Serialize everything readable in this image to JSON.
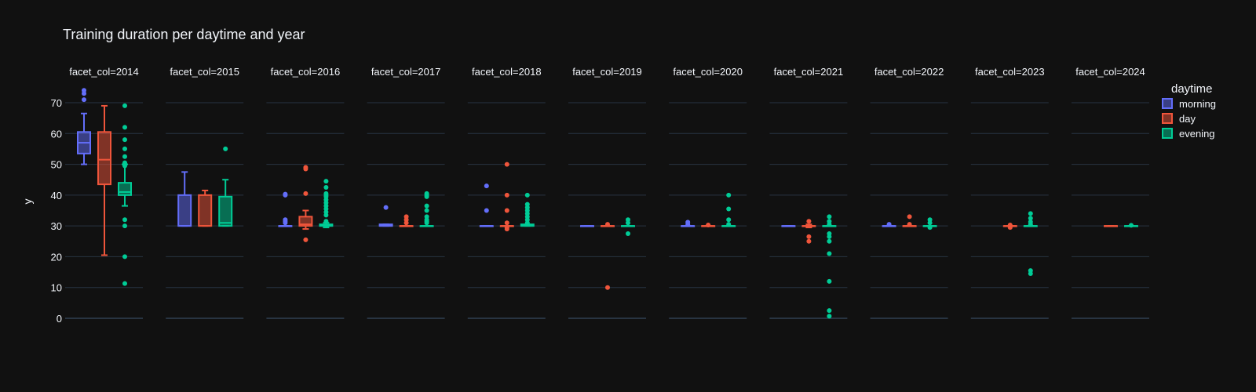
{
  "chart_data": {
    "type": "box",
    "title": "Training duration per daytime and year",
    "ylabel": "y",
    "ylim": [
      0,
      75
    ],
    "yticks": [
      0,
      10,
      20,
      30,
      40,
      50,
      60,
      70
    ],
    "facet_prefix": "facet_col=",
    "legend_title": "daytime",
    "legend_position": "right",
    "grid": true,
    "facets": [
      {
        "label": "facet_col=2014",
        "boxes": {
          "morning": {
            "q1": 53.5,
            "median": 57,
            "q3": 60.5,
            "low": 50,
            "high": 66.5,
            "outliers": [
              71,
              73,
              74
            ]
          },
          "day": {
            "q1": 43.5,
            "median": 51.5,
            "q3": 60.5,
            "low": 20.5,
            "high": 69,
            "outliers": []
          },
          "evening": {
            "q1": 40,
            "median": 41,
            "q3": 44,
            "low": 36.5,
            "high": 50,
            "outliers": [
              11.3,
              20,
              30,
              32,
              49.5,
              50.5,
              52.5,
              55,
              58,
              62,
              69
            ]
          }
        }
      },
      {
        "label": "facet_col=2015",
        "boxes": {
          "morning": {
            "q1": 30,
            "median": 30,
            "q3": 40,
            "low": 30,
            "high": 47.5,
            "outliers": []
          },
          "day": {
            "q1": 30,
            "median": 30,
            "q3": 40,
            "low": 30,
            "high": 41.5,
            "outliers": []
          },
          "evening": {
            "q1": 30,
            "median": 31,
            "q3": 39.5,
            "low": 30,
            "high": 45,
            "outliers": [
              55
            ]
          }
        }
      },
      {
        "label": "facet_col=2016",
        "boxes": {
          "morning": {
            "q1": 30,
            "median": 30,
            "q3": 30,
            "low": 30,
            "high": 30,
            "outliers": [
              31,
              31.5,
              32,
              40,
              40.3
            ]
          },
          "day": {
            "q1": 30,
            "median": 30.5,
            "q3": 33,
            "low": 29,
            "high": 35,
            "outliers": [
              25.5,
              40.5,
              48.5,
              49
            ]
          },
          "evening": {
            "q1": 30,
            "median": 30,
            "q3": 30.5,
            "low": 29.5,
            "high": 31,
            "outliers": [
              31.5,
              33.5,
              34.5,
              35.5,
              36.5,
              37.5,
              38.5,
              39.5,
              40,
              40.5,
              42.5,
              44.5
            ]
          }
        }
      },
      {
        "label": "facet_col=2017",
        "boxes": {
          "morning": {
            "q1": 30,
            "median": 30,
            "q3": 30.5,
            "low": 30,
            "high": 30.5,
            "outliers": [
              36
            ]
          },
          "day": {
            "q1": 30,
            "median": 30,
            "q3": 30,
            "low": 30,
            "high": 30,
            "outliers": [
              31,
              32,
              33
            ]
          },
          "evening": {
            "q1": 30,
            "median": 30,
            "q3": 30,
            "low": 30,
            "high": 30,
            "outliers": [
              31,
              31.5,
              32,
              33,
              35,
              36.5,
              39.5,
              40,
              40.5
            ]
          }
        }
      },
      {
        "label": "facet_col=2018",
        "boxes": {
          "morning": {
            "q1": 30,
            "median": 30,
            "q3": 30,
            "low": 30,
            "high": 30,
            "outliers": [
              35,
              43
            ]
          },
          "day": {
            "q1": 30,
            "median": 30,
            "q3": 30,
            "low": 30,
            "high": 30,
            "outliers": [
              29,
              29.5,
              31,
              35,
              40,
              50
            ]
          },
          "evening": {
            "q1": 30,
            "median": 30,
            "q3": 30.5,
            "low": 30,
            "high": 30.5,
            "outliers": [
              31,
              32,
              33,
              34,
              35,
              36,
              37,
              40
            ]
          }
        }
      },
      {
        "label": "facet_col=2019",
        "boxes": {
          "morning": {
            "q1": 30,
            "median": 30,
            "q3": 30,
            "low": 30,
            "high": 30,
            "outliers": []
          },
          "day": {
            "q1": 30,
            "median": 30,
            "q3": 30,
            "low": 30,
            "high": 30,
            "outliers": [
              10,
              30.5
            ]
          },
          "evening": {
            "q1": 30,
            "median": 30,
            "q3": 30,
            "low": 30,
            "high": 30,
            "outliers": [
              27.5,
              31,
              32
            ]
          }
        }
      },
      {
        "label": "facet_col=2020",
        "boxes": {
          "morning": {
            "q1": 30,
            "median": 30,
            "q3": 30,
            "low": 30,
            "high": 30,
            "outliers": [
              30.5,
              31.2
            ]
          },
          "day": {
            "q1": 30,
            "median": 30,
            "q3": 30,
            "low": 30,
            "high": 30,
            "outliers": [
              30.3
            ]
          },
          "evening": {
            "q1": 30,
            "median": 30,
            "q3": 30,
            "low": 30,
            "high": 30,
            "outliers": [
              30.5,
              32,
              35.5,
              40
            ]
          }
        }
      },
      {
        "label": "facet_col=2021",
        "boxes": {
          "morning": {
            "q1": 30,
            "median": 30,
            "q3": 30,
            "low": 30,
            "high": 30,
            "outliers": []
          },
          "day": {
            "q1": 30,
            "median": 30,
            "q3": 30,
            "low": 29.5,
            "high": 30.5,
            "outliers": [
              25,
              26.5,
              31.5
            ]
          },
          "evening": {
            "q1": 30,
            "median": 30,
            "q3": 30,
            "low": 30,
            "high": 30,
            "outliers": [
              0.7,
              2.5,
              12,
              21,
              25,
              26.5,
              27.5,
              30.5,
              31.5,
              33
            ]
          }
        }
      },
      {
        "label": "facet_col=2022",
        "boxes": {
          "morning": {
            "q1": 30,
            "median": 30,
            "q3": 30,
            "low": 30,
            "high": 30,
            "outliers": [
              30.5
            ]
          },
          "day": {
            "q1": 30,
            "median": 30,
            "q3": 30,
            "low": 30,
            "high": 30,
            "outliers": [
              30.5,
              33
            ]
          },
          "evening": {
            "q1": 30,
            "median": 30,
            "q3": 30,
            "low": 30,
            "high": 30,
            "outliers": [
              29.5,
              31,
              32
            ]
          }
        }
      },
      {
        "label": "facet_col=2023",
        "boxes": {
          "morning": null,
          "day": {
            "q1": 30,
            "median": 30,
            "q3": 30,
            "low": 30,
            "high": 30,
            "outliers": [
              29.5,
              30.3
            ]
          },
          "evening": {
            "q1": 30,
            "median": 30,
            "q3": 30,
            "low": 30,
            "high": 30,
            "outliers": [
              14.5,
              15.5,
              30.5,
              31.3,
              32.5,
              34
            ]
          }
        }
      },
      {
        "label": "facet_col=2024",
        "boxes": {
          "morning": null,
          "day": {
            "q1": 30,
            "median": 30,
            "q3": 30,
            "low": 30,
            "high": 30,
            "outliers": []
          },
          "evening": {
            "q1": 30,
            "median": 30,
            "q3": 30,
            "low": 30,
            "high": 30,
            "outliers": [
              30.2
            ]
          }
        }
      }
    ],
    "series": [
      {
        "name": "morning",
        "color": "#636efa"
      },
      {
        "name": "day",
        "color": "#ef553b"
      },
      {
        "name": "evening",
        "color": "#00cc96"
      }
    ]
  },
  "colors": {
    "background": "#111111",
    "grid": "#283442",
    "zeroline": "#283442",
    "text": "#f2f5fa"
  }
}
